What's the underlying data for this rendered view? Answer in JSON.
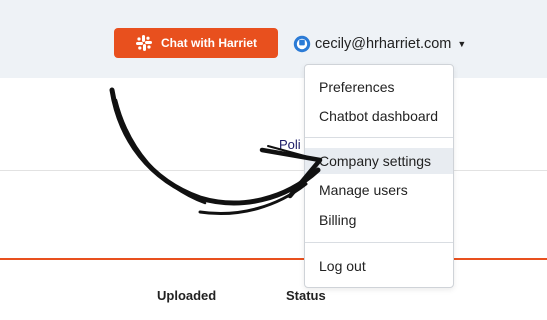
{
  "header": {
    "chat_button_label": "Chat with Harriet",
    "account_email": "cecily@hrharriet.com",
    "accent_color": "#e8501e"
  },
  "page": {
    "partial_link": "Poli",
    "columns": [
      "Uploaded",
      "Status"
    ]
  },
  "dropdown": {
    "items": [
      "Preferences",
      "Chatbot dashboard",
      "Company settings",
      "Manage users",
      "Billing",
      "Log out"
    ],
    "highlighted": "Company settings"
  }
}
